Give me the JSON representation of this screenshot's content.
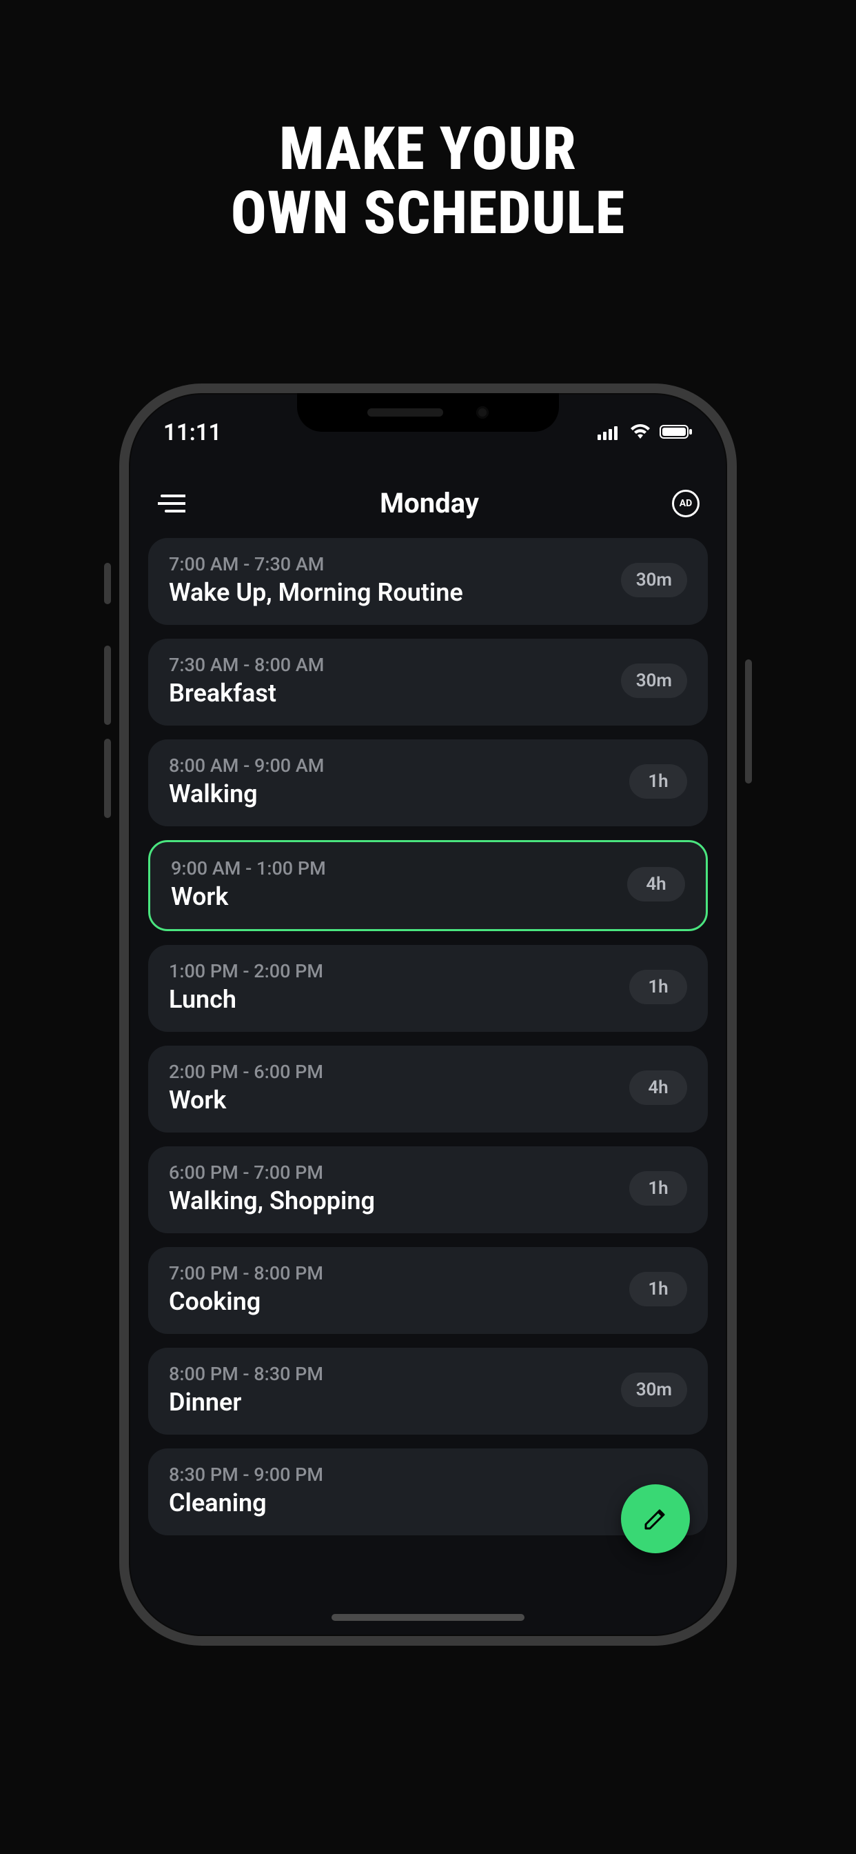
{
  "headline": {
    "line1": "MAKE YOUR",
    "line2": "OWN SCHEDULE"
  },
  "status": {
    "time": "11:11"
  },
  "header": {
    "title": "Monday",
    "ad_label": "AD"
  },
  "schedule": {
    "items": [
      {
        "time": "7:00 AM - 7:30 AM",
        "title": "Wake Up, Morning Routine",
        "duration": "30m",
        "active": false
      },
      {
        "time": "7:30 AM - 8:00 AM",
        "title": "Breakfast",
        "duration": "30m",
        "active": false
      },
      {
        "time": "8:00 AM - 9:00 AM",
        "title": "Walking",
        "duration": "1h",
        "active": false
      },
      {
        "time": "9:00 AM - 1:00 PM",
        "title": "Work",
        "duration": "4h",
        "active": true
      },
      {
        "time": "1:00 PM - 2:00 PM",
        "title": "Lunch",
        "duration": "1h",
        "active": false
      },
      {
        "time": "2:00 PM - 6:00 PM",
        "title": "Work",
        "duration": "4h",
        "active": false
      },
      {
        "time": "6:00 PM - 7:00 PM",
        "title": "Walking, Shopping",
        "duration": "1h",
        "active": false
      },
      {
        "time": "7:00 PM - 8:00 PM",
        "title": "Cooking",
        "duration": "1h",
        "active": false
      },
      {
        "time": "8:00 PM - 8:30 PM",
        "title": "Dinner",
        "duration": "30m",
        "active": false
      },
      {
        "time": "8:30 PM - 9:00 PM",
        "title": "Cleaning",
        "duration": "",
        "active": false
      }
    ]
  }
}
